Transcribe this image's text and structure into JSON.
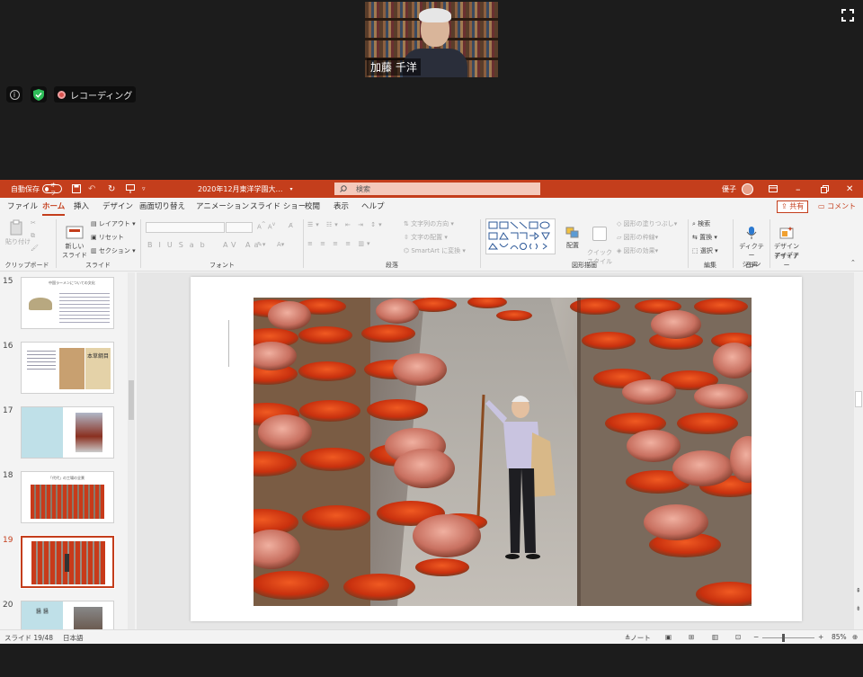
{
  "meeting": {
    "participant_name": "加藤 千洋",
    "recording_label": "レコーディング"
  },
  "ppt": {
    "autosave_label": "自動保存",
    "autosave_state": "オフ",
    "doc_title": "2020年12月東洋学園大…",
    "search_placeholder": "検索",
    "user_name": "優子",
    "tabs": [
      "ファイル",
      "ホーム",
      "挿入",
      "デザイン",
      "画面切り替え",
      "アニメーション",
      "スライド ショー",
      "校閲",
      "表示",
      "ヘルプ"
    ],
    "active_tab": "ホーム",
    "share_label": "共有",
    "comment_label": "コメント",
    "ribbon": {
      "clipboard": {
        "paste": "貼り付け",
        "label": "クリップボード"
      },
      "slides": {
        "new_slide": "新しい\nスライド",
        "layout": "レイアウト",
        "reset": "リセット",
        "section": "セクション",
        "label": "スライド"
      },
      "font": {
        "label": "フォント"
      },
      "paragraph": {
        "text_direction": "文字列の方向",
        "align_text": "文字の配置",
        "smartart": "SmartArt に変換",
        "label": "段落"
      },
      "drawing": {
        "arrange": "配置",
        "quick_style": "クイック\nスタイル",
        "shape_fill": "図形の塗りつぶし",
        "shape_outline": "図形の枠線",
        "shape_effects": "図形の効果",
        "label": "図形描画"
      },
      "editing": {
        "find": "検索",
        "replace": "置換",
        "select": "選択",
        "label": "編集"
      },
      "voice": {
        "dictate": "ディクテー\nション",
        "label": "音声"
      },
      "designer": {
        "ideas": "デザイン\nアイデア",
        "label": "デザイナー"
      }
    },
    "thumbnails": [
      {
        "num": "15",
        "caption": "中国ラーメンについての文化"
      },
      {
        "num": "16",
        "caption": "本草綱目"
      },
      {
        "num": "17",
        "caption": ""
      },
      {
        "num": "18",
        "caption": "「代代」の工場の全景"
      },
      {
        "num": "19",
        "caption": ""
      },
      {
        "num": "20",
        "caption": "醤 醤"
      }
    ],
    "selected_slide": "19",
    "status": {
      "slide_counter": "スライド 19/48",
      "language": "日本語",
      "notes": "ノート",
      "zoom": "85%"
    }
  },
  "colors": {
    "accent": "#c43e1c",
    "zoom_bg": "#1c1c1c"
  }
}
